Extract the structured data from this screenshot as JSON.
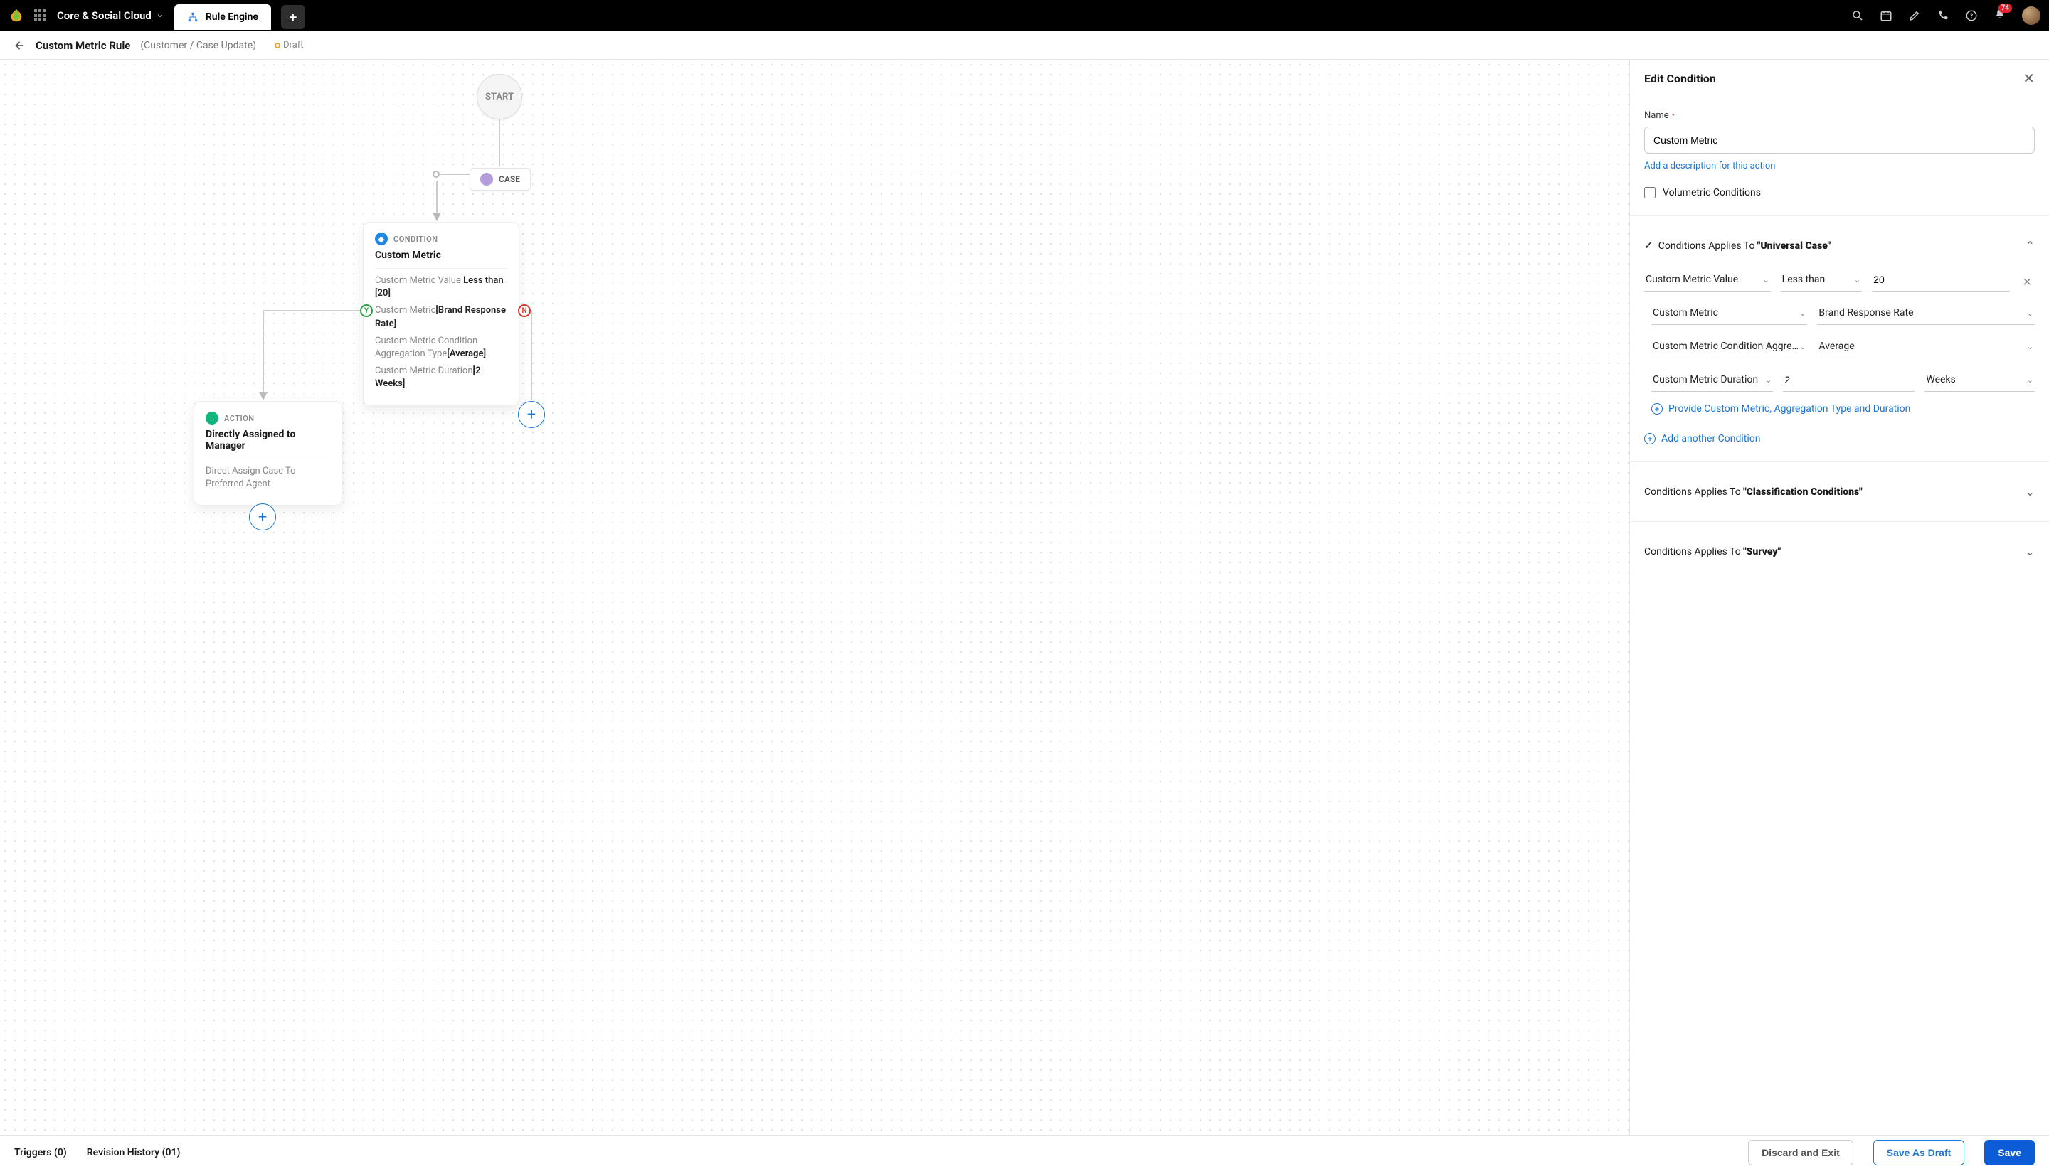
{
  "nav": {
    "brand": "Core & Social Cloud",
    "tab_label": "Rule Engine",
    "notif_count": "74"
  },
  "subheader": {
    "title": "Custom Metric Rule",
    "meta": "(Customer / Case Update)",
    "status": "Draft"
  },
  "canvas": {
    "start": "START",
    "case_label": "CASE",
    "condition": {
      "label": "CONDITION",
      "title": "Custom Metric",
      "l1a": "Custom Metric Value ",
      "l1b": "Less than [20]",
      "l2a": "Custom Metric",
      "l2b": "[Brand Response Rate]",
      "l3a": "Custom Metric Condition Aggregation Type",
      "l3b": "[Average]",
      "l4a": "Custom Metric Duration",
      "l4b": "[2 Weeks]"
    },
    "action": {
      "label": "ACTION",
      "title": "Directly Assigned to Manager",
      "desc": "Direct Assign Case To Preferred Agent"
    },
    "yes": "Y",
    "no": "N"
  },
  "panel": {
    "heading": "Edit Condition",
    "name_label": "Name",
    "name_value": "Custom Metric",
    "add_desc": "Add a description for this action",
    "volumetric": "Volumetric Conditions",
    "sec1_prefix": "Conditions Applies To ",
    "sec1_target": "\"Universal Case\"",
    "row1": {
      "field": "Custom Metric Value",
      "op": "Less than",
      "val": "20"
    },
    "row2": {
      "a": "Custom Metric",
      "b": "Brand Response Rate"
    },
    "row3": {
      "a": "Custom Metric Condition Aggre…",
      "b": "Average"
    },
    "row4": {
      "a": "Custom Metric Duration",
      "num": "2",
      "unit": "Weeks"
    },
    "provide_link": "Provide Custom Metric, Aggregation Type and Duration",
    "add_cond": "Add another Condition",
    "sec2_prefix": "Conditions Applies To ",
    "sec2_target": "\"Classification Conditions\"",
    "sec3_prefix": "Conditions Applies To ",
    "sec3_target": "\"Survey\""
  },
  "footer": {
    "triggers": "Triggers (0)",
    "revision": "Revision History (01)",
    "discard": "Discard and Exit",
    "draft": "Save As Draft",
    "save": "Save"
  }
}
